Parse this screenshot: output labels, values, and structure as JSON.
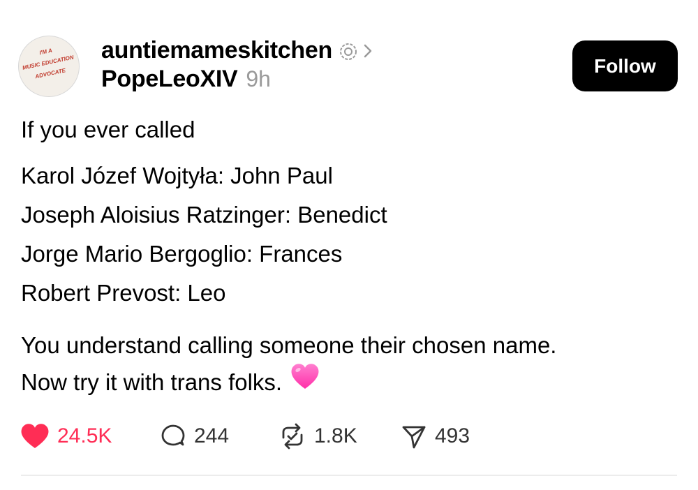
{
  "post": {
    "author": {
      "avatar_lines": [
        "I'M A",
        "MUSIC EDUCATION",
        "ADVOCATE"
      ],
      "username": "auntiemameskitchen",
      "tagged": "PopeLeoXIV",
      "timestamp": "9h"
    },
    "follow_label": "Follow",
    "body": {
      "intro": "If you ever called",
      "names": [
        "Karol Józef Wojtyła: John Paul",
        "Joseph Aloisius Ratzinger: Benedict",
        "Jorge Mario Bergoglio: Frances",
        "Robert Prevost: Leo"
      ],
      "closing_line1": "You understand calling someone their chosen name.",
      "closing_line2": "Now try it with trans folks."
    },
    "actions": {
      "likes": "24.5K",
      "replies": "244",
      "reposts": "1.8K",
      "shares": "493"
    }
  },
  "colors": {
    "like": "#ff2d55",
    "follow_bg": "#000000",
    "timestamp": "#9a9a9a",
    "heart_emoji": "#ff4fb8"
  },
  "icons": [
    "verified-badge-icon",
    "chevron-right-icon",
    "heart-icon",
    "reply-icon",
    "repost-icon",
    "share-icon",
    "heart-emoji-icon"
  ]
}
